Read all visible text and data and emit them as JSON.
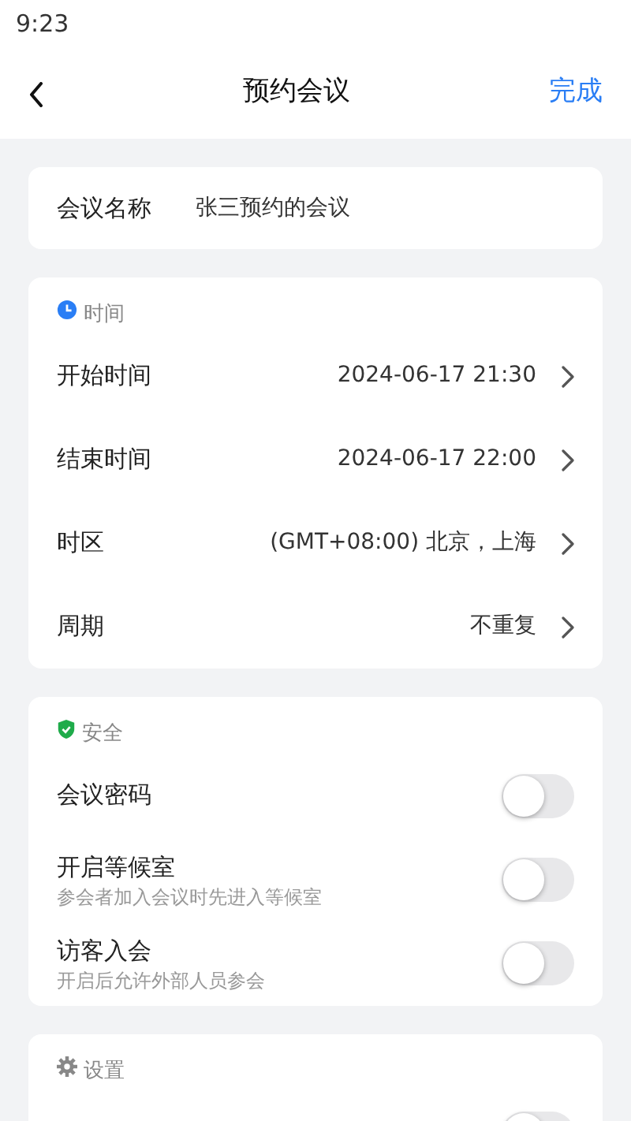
{
  "status_bar": {
    "time": "9:23"
  },
  "header": {
    "title": "预约会议",
    "done": "完成"
  },
  "name_row": {
    "label": "会议名称",
    "value": "张三预约的会议"
  },
  "time_section": {
    "title": "时间",
    "rows": [
      {
        "label": "开始时间",
        "value": "2024-06-17 21:30"
      },
      {
        "label": "结束时间",
        "value": "2024-06-17 22:00"
      },
      {
        "label": "时区",
        "value": "(GMT+08:00) 北京，上海"
      },
      {
        "label": "周期",
        "value": "不重复"
      }
    ]
  },
  "security_section": {
    "title": "安全",
    "rows": [
      {
        "label": "会议密码",
        "on": false
      },
      {
        "label": "开启等候室",
        "hint": "参会者加入会议时先进入等候室",
        "on": false
      },
      {
        "label": "访客入会",
        "hint": "开启后允许外部人员参会",
        "on": false
      }
    ]
  },
  "settings_section": {
    "title": "设置",
    "rows": [
      {
        "on": false
      }
    ]
  }
}
